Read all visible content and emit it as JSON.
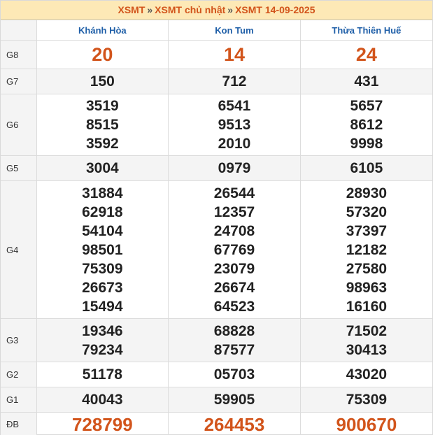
{
  "breadcrumb": {
    "items": [
      "XSMT",
      "XSMT chủ nhật",
      "XSMT 14-09-2025"
    ],
    "separator": "»"
  },
  "provinces": [
    "Khánh Hòa",
    "Kon Tum",
    "Thừa Thiên Huế"
  ],
  "prizes": [
    {
      "label": "G8",
      "values": [
        [
          "20"
        ],
        [
          "14"
        ],
        [
          "24"
        ]
      ]
    },
    {
      "label": "G7",
      "values": [
        [
          "150"
        ],
        [
          "712"
        ],
        [
          "431"
        ]
      ]
    },
    {
      "label": "G6",
      "values": [
        [
          "3519",
          "8515",
          "3592"
        ],
        [
          "6541",
          "9513",
          "2010"
        ],
        [
          "5657",
          "8612",
          "9998"
        ]
      ]
    },
    {
      "label": "G5",
      "values": [
        [
          "3004"
        ],
        [
          "0979"
        ],
        [
          "6105"
        ]
      ]
    },
    {
      "label": "G4",
      "values": [
        [
          "31884",
          "62918",
          "54104",
          "98501",
          "75309",
          "26673",
          "15494"
        ],
        [
          "26544",
          "12357",
          "24708",
          "67769",
          "23079",
          "26674",
          "64523"
        ],
        [
          "28930",
          "57320",
          "37397",
          "12182",
          "27580",
          "98963",
          "16160"
        ]
      ]
    },
    {
      "label": "G3",
      "values": [
        [
          "19346",
          "79234"
        ],
        [
          "68828",
          "87577"
        ],
        [
          "71502",
          "30413"
        ]
      ]
    },
    {
      "label": "G2",
      "values": [
        [
          "51178"
        ],
        [
          "05703"
        ],
        [
          "43020"
        ]
      ]
    },
    {
      "label": "G1",
      "values": [
        [
          "40043"
        ],
        [
          "59905"
        ],
        [
          "75309"
        ]
      ]
    },
    {
      "label": "ĐB",
      "values": [
        [
          "728799"
        ],
        [
          "264453"
        ],
        [
          "900670"
        ]
      ]
    }
  ],
  "colors": {
    "accent": "#d2541b",
    "header_text": "#1f5fa8",
    "title_bg": "#fde9b6"
  }
}
